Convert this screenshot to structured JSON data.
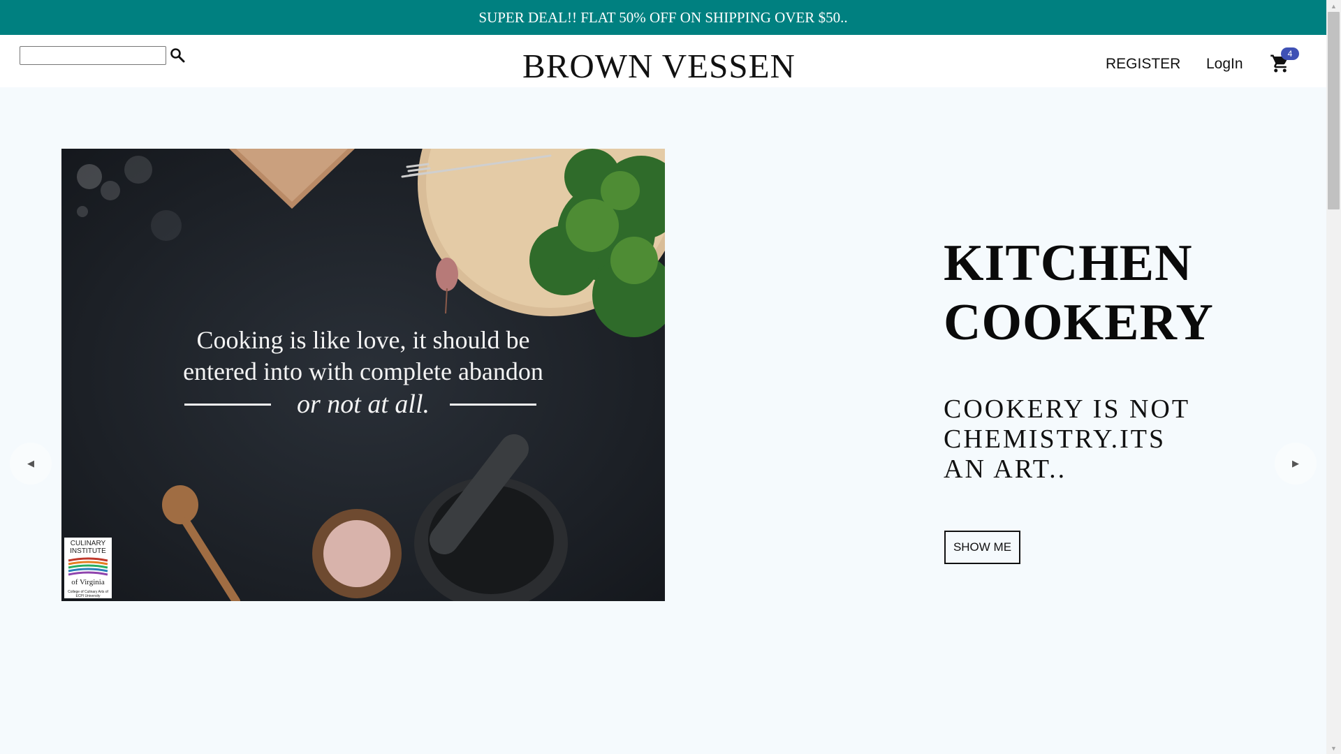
{
  "announcement": {
    "text": "SUPER DEAL!! FLAT 50% OFF ON SHIPPING OVER $50.."
  },
  "header": {
    "search": {
      "value": "",
      "placeholder": "",
      "icon": "search-icon"
    },
    "brand": "BROWN VESSEN",
    "nav": {
      "register_label": "REGISTER",
      "login_label": "LogIn"
    },
    "cart": {
      "icon": "shopping-cart-icon",
      "count": "4",
      "badge_color": "#3f51b5"
    }
  },
  "slider": {
    "image": {
      "quote_line1": "Cooking is like love, it should be",
      "quote_line2": "entered into with complete abandon",
      "quote_line3": "or not at all.",
      "badge": {
        "line1": "CULINARY",
        "line2": "INSTITUTE",
        "line3": "of Virginia",
        "line4": "College of Culinary Arts of ECPI University"
      }
    },
    "title_line1": "KITCHEN",
    "title_line2": "COOKERY",
    "subtitle_line1": "COOKERY IS NOT",
    "subtitle_line2": "CHEMISTRY.ITS",
    "subtitle_line3": "AN ART..",
    "button_label": "SHOW ME",
    "prev_icon": "caret-left-icon",
    "next_icon": "caret-right-icon"
  },
  "colors": {
    "announcement_bg": "#008080",
    "page_bg": "#f5fafd",
    "header_bg": "#ffffff",
    "badge": "#3f51b5"
  }
}
